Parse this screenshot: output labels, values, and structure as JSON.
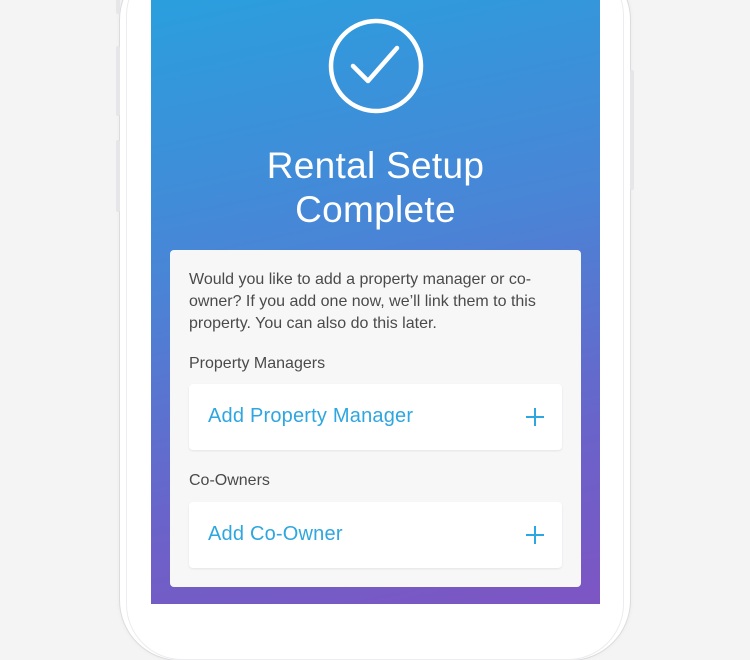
{
  "header": {
    "icon": "check-circle-icon",
    "title_line1": "Rental Setup",
    "title_line2": "Complete"
  },
  "card": {
    "intro": "Would you like to add a property manager or co-owner? If you add one now, we’ll link them to this property. You can also do this later.",
    "property_managers": {
      "section_label": "Property Managers",
      "add_label": "Add Property Manager",
      "icon": "plus-icon"
    },
    "co_owners": {
      "section_label": "Co-Owners",
      "add_label": "Add Co-Owner",
      "icon": "plus-icon"
    }
  },
  "colors": {
    "gradient_top": "#2a9fde",
    "gradient_bottom": "#7d55c3",
    "accent": "#2ea6df",
    "card_bg": "#f7f7f8"
  }
}
